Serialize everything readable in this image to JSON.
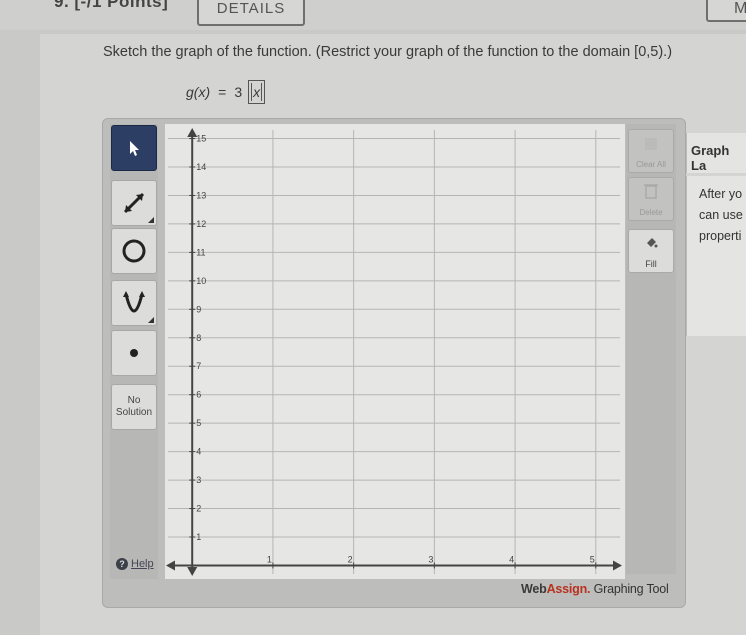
{
  "header": {
    "points": "9. [-/1 Points]",
    "details_label": "DETAILS",
    "my_label": "MY"
  },
  "prompt": "Sketch the graph of the function. (Restrict your graph of the function to the domain [0,5).)",
  "function": {
    "lhs": "g(x)",
    "eq": "=",
    "coef": "3",
    "arg": "x"
  },
  "tools": [
    "pointer",
    "line",
    "circle",
    "parabola",
    "point"
  ],
  "no_solution": {
    "line1": "No",
    "line2": "Solution"
  },
  "help_label": "Help",
  "right_buttons": {
    "clear_all": "Clear All",
    "delete": "Delete",
    "fill": "Fill"
  },
  "brand": {
    "web": "Web",
    "assign": "Assign.",
    "rest": " Graphing Tool"
  },
  "side": {
    "title": "Graph La",
    "line1": "After yo",
    "line2": "can use",
    "line3": "properti"
  },
  "chart_data": {
    "type": "grid",
    "x_ticks": [
      "1",
      "2",
      "3",
      "4",
      "5"
    ],
    "y_ticks": [
      "1",
      "2",
      "3",
      "4",
      "5",
      "6",
      "7",
      "8",
      "9",
      "10",
      "11",
      "12",
      "13",
      "14",
      "15"
    ],
    "xlim": [
      -0.3,
      5.3
    ],
    "ylim": [
      -0.3,
      15.3
    ],
    "grid": true
  },
  "colors": {
    "accent": "#2c3e64",
    "brand_red": "#b8321f"
  }
}
